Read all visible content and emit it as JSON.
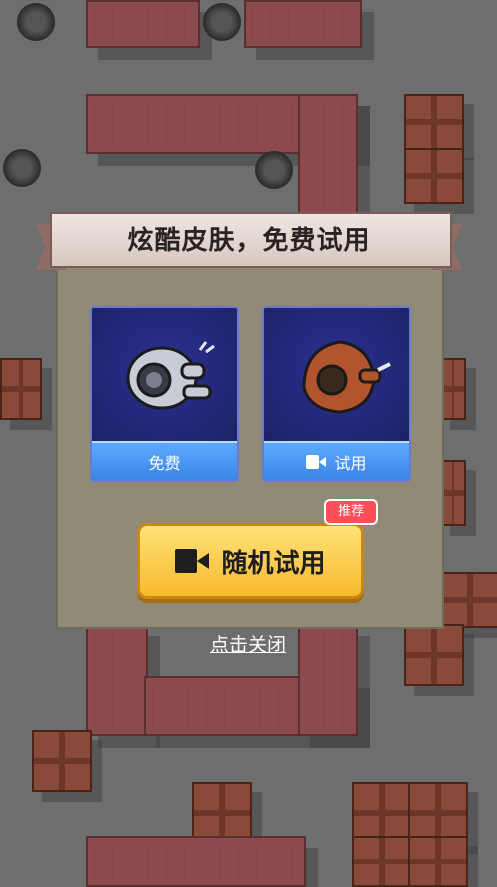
{
  "dialog": {
    "title": "炫酷皮肤，免费试用",
    "skins": [
      {
        "label": "免费",
        "figure_color": "#c9cbd6",
        "has_video_icon": false
      },
      {
        "label": "试用",
        "figure_color": "#b2542c",
        "has_video_icon": true
      }
    ],
    "random_button": {
      "label": "随机试用",
      "icon": "video-camera-icon"
    },
    "recommend_badge": "推荐",
    "close_link": "点击关闭"
  },
  "colors": {
    "panel": "#918a76",
    "card_blue": "#23287a",
    "action_blue": "#4a97f2",
    "button_yellow": "#f7c744",
    "badge_red": "#ff4d5a",
    "wall": "#8c4a4e",
    "floor": "#6e6e6e"
  }
}
